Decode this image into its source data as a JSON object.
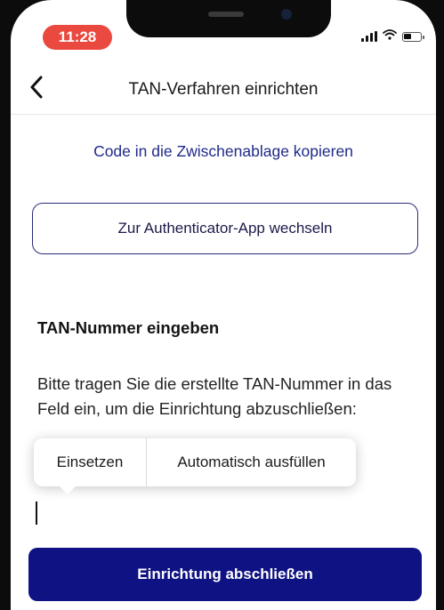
{
  "status_bar": {
    "time": "11:28",
    "icons": [
      "signal-icon",
      "wifi-icon",
      "battery-icon"
    ]
  },
  "nav": {
    "back_icon": "chevron-left-icon",
    "title": "TAN-Verfahren einrichten"
  },
  "main": {
    "copy_link": "Code in die Zwischenablage kopieren",
    "switch_button": "Zur Authenticator-App wechseln",
    "section_title": "TAN-Nummer eingeben",
    "description": "Bitte tragen Sie die erstellte TAN-Nummer in das Feld ein, um die Einrichtung abzuschließen:",
    "input_value": ""
  },
  "context_menu": {
    "items": [
      "Einsetzen",
      "Automatisch ausfüllen"
    ]
  },
  "footer": {
    "primary_button": "Einrichtung abschließen"
  },
  "colors": {
    "accent": "#0f1282",
    "link": "#1f2a8a",
    "time_pill": "#e9493f"
  }
}
